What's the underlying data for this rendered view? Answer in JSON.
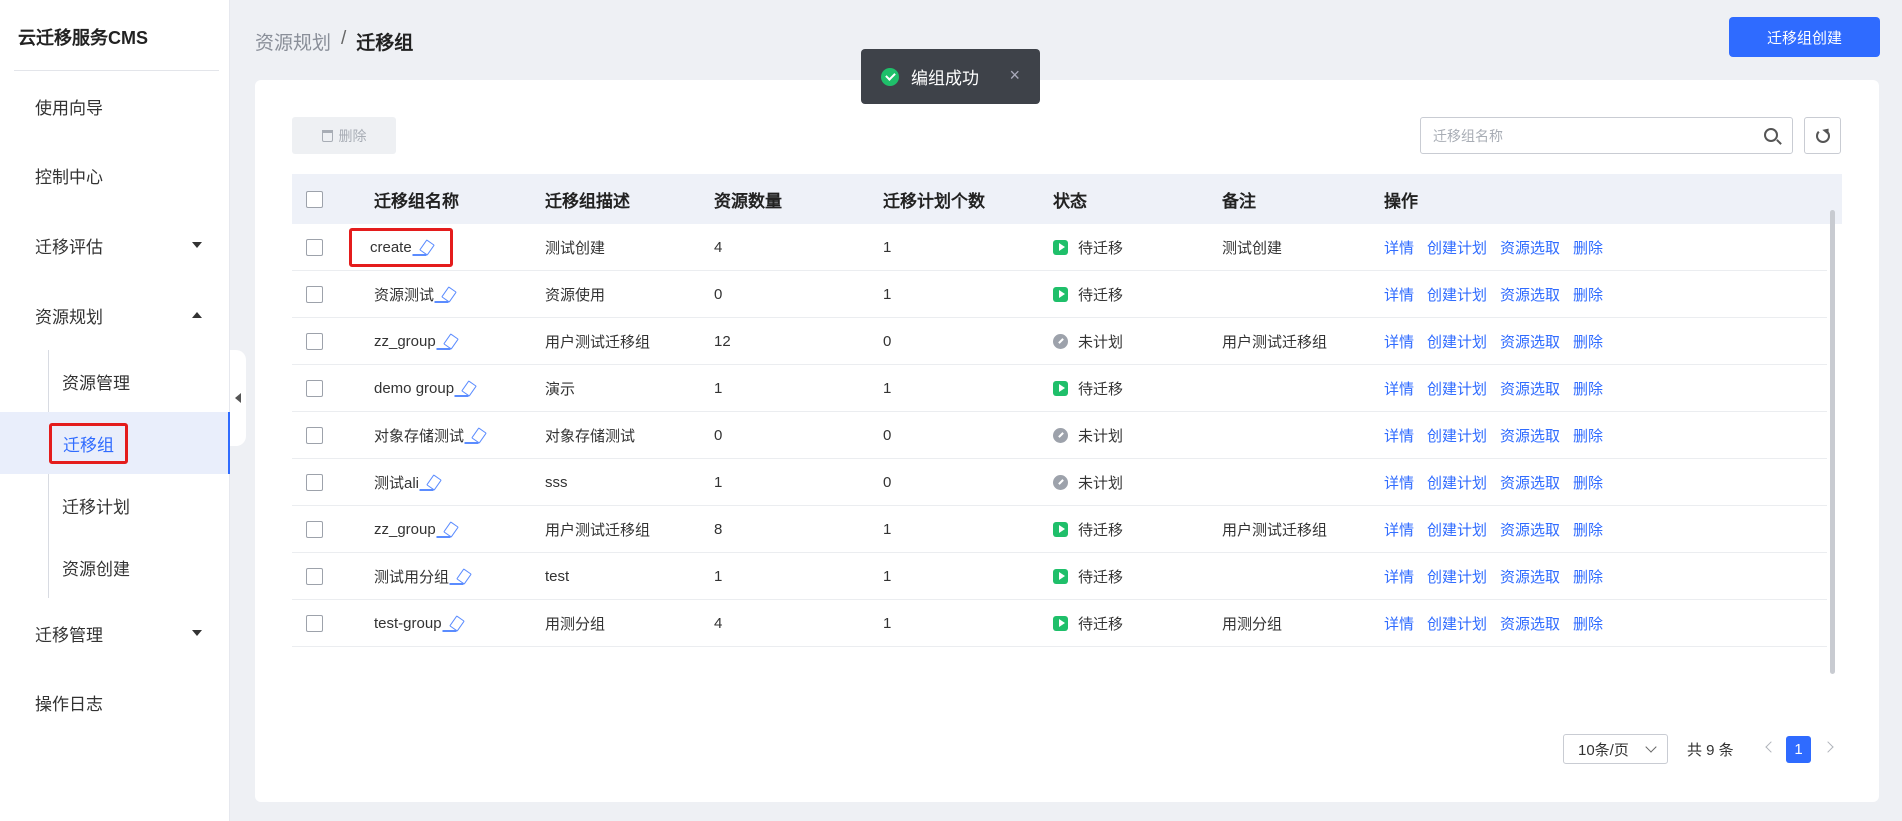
{
  "app": {
    "title": "云迁移服务CMS"
  },
  "sidebar": {
    "items": [
      {
        "label": "使用向导"
      },
      {
        "label": "控制中心"
      },
      {
        "label": "迁移评估"
      },
      {
        "label": "资源规划"
      },
      {
        "label": "迁移管理"
      },
      {
        "label": "操作日志"
      }
    ],
    "sub_items": [
      {
        "label": "资源管理"
      },
      {
        "label": "迁移组"
      },
      {
        "label": "迁移计划"
      },
      {
        "label": "资源创建"
      }
    ]
  },
  "breadcrumb": {
    "parent": "资源规划",
    "separator": "/",
    "current": "迁移组"
  },
  "header": {
    "create_button": "迁移组创建"
  },
  "toast": {
    "message": "编组成功",
    "close": "×"
  },
  "toolbar": {
    "delete_label": "删除",
    "search_placeholder": "迁移组名称"
  },
  "table": {
    "headers": {
      "name": "迁移组名称",
      "desc": "迁移组描述",
      "count": "资源数量",
      "plans": "迁移计划个数",
      "status": "状态",
      "note": "备注",
      "ops": "操作"
    },
    "ops": {
      "detail": "详情",
      "create_plan": "创建计划",
      "select": "资源选取",
      "delete": "删除"
    },
    "rows": [
      {
        "name": "create",
        "desc": "测试创建",
        "count": "4",
        "plans": "1",
        "status": "待迁移",
        "status_type": "play",
        "note": "测试创建"
      },
      {
        "name": "资源测试",
        "desc": "资源使用",
        "count": "0",
        "plans": "1",
        "status": "待迁移",
        "status_type": "play",
        "note": ""
      },
      {
        "name": "zz_group",
        "desc": "用户测试迁移组",
        "count": "12",
        "plans": "0",
        "status": "未计划",
        "status_type": "clock",
        "note": "用户测试迁移组"
      },
      {
        "name": "demo group",
        "desc": "演示",
        "count": "1",
        "plans": "1",
        "status": "待迁移",
        "status_type": "play",
        "note": ""
      },
      {
        "name": "对象存储测试",
        "desc": "对象存储测试",
        "count": "0",
        "plans": "0",
        "status": "未计划",
        "status_type": "clock",
        "note": ""
      },
      {
        "name": "测试ali",
        "desc": "sss",
        "count": "1",
        "plans": "0",
        "status": "未计划",
        "status_type": "clock",
        "note": ""
      },
      {
        "name": "zz_group",
        "desc": "用户测试迁移组",
        "count": "8",
        "plans": "1",
        "status": "待迁移",
        "status_type": "play",
        "note": "用户测试迁移组"
      },
      {
        "name": "测试用分组",
        "desc": "test",
        "count": "1",
        "plans": "1",
        "status": "待迁移",
        "status_type": "play",
        "note": ""
      },
      {
        "name": "test-group",
        "desc": "用测分组",
        "count": "4",
        "plans": "1",
        "status": "待迁移",
        "status_type": "play",
        "note": "用测分组"
      }
    ]
  },
  "pagination": {
    "page_size": "10条/页",
    "total": "共 9 条",
    "current": "1"
  },
  "colors": {
    "accent": "#2f6bff",
    "success": "#1fbf6a",
    "highlight": "#e41c1c"
  }
}
